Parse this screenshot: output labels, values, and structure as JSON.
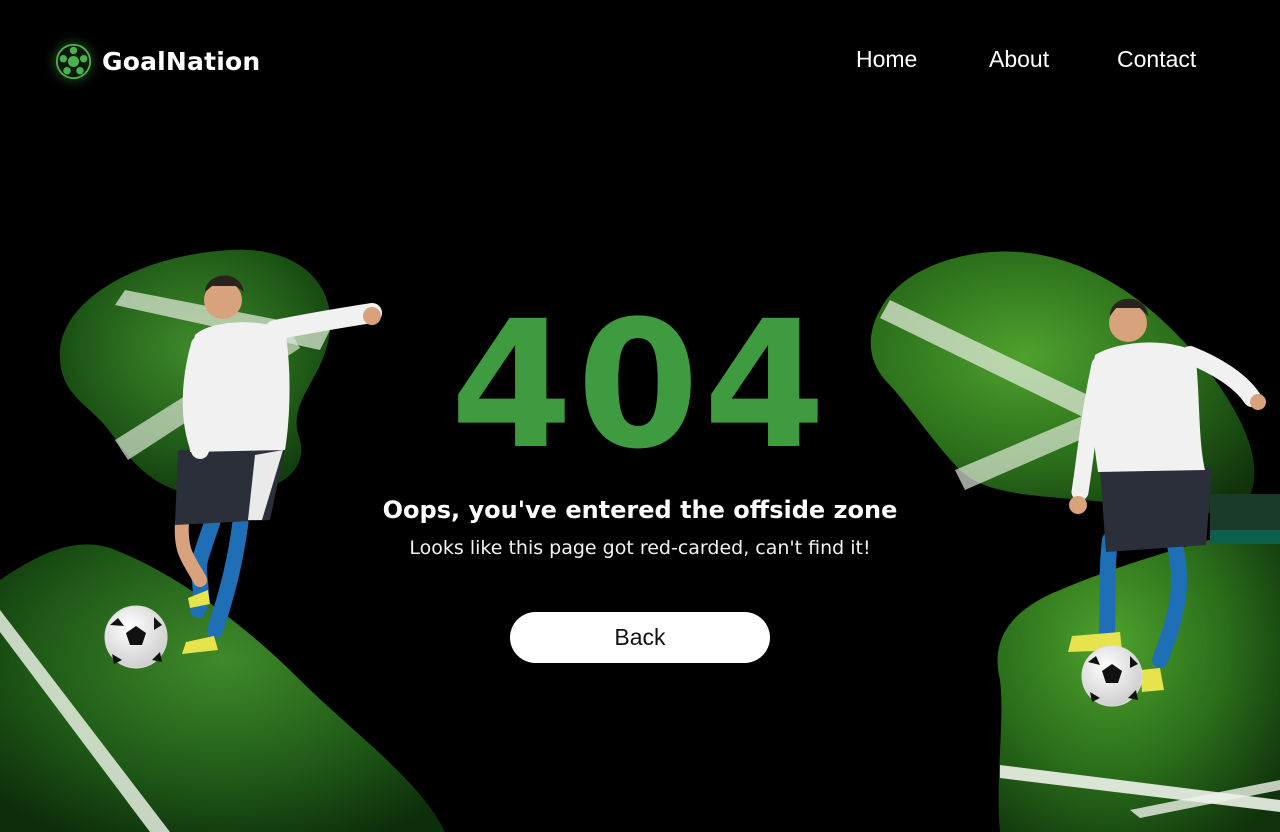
{
  "header": {
    "brand_name": "GoalNation",
    "logo_icon": "soccer-ball-icon",
    "nav": [
      {
        "label": "Home"
      },
      {
        "label": "About"
      },
      {
        "label": "Contact"
      }
    ]
  },
  "error": {
    "code": "404",
    "headline": "Oops, you've entered the offside zone",
    "message": "Looks like this page got red-carded, can't find it!",
    "back_label": "Back"
  },
  "colors": {
    "background": "#000000",
    "accent_green": "#3f9b3f",
    "button_bg": "#ffffff",
    "text": "#ffffff"
  }
}
